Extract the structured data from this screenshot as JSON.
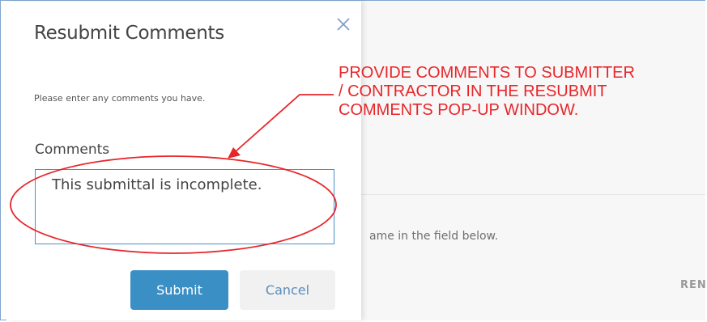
{
  "dialog": {
    "title": "Resubmit Comments",
    "close_icon": "close-icon",
    "instructions": "Please enter any comments you have.",
    "comments_label": "Comments",
    "comments_value": "This submittal is incomplete.",
    "submit_label": "Submit",
    "cancel_label": "Cancel"
  },
  "background": {
    "field_hint": "ame in the field below.",
    "action_label": "REN"
  },
  "annotation": {
    "text": "PROVIDE COMMENTS TO SUBMITTER\n/ CONTRACTOR IN THE RESUBMIT\nCOMMENTS POP-UP WINDOW.",
    "color": "#e8262a"
  },
  "colors": {
    "accent": "#3a8fc4",
    "link": "#5a8dbb",
    "frame_border": "#7fa6cf"
  }
}
